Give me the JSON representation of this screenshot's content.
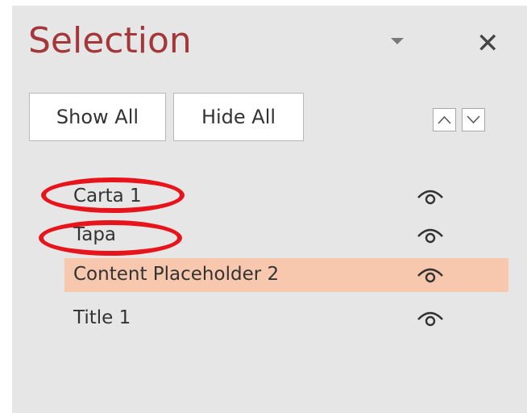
{
  "pane": {
    "title": "Selection",
    "menu_icon": "chevron-down-icon",
    "close_icon": "close-icon",
    "close_glyph": "✕"
  },
  "toolbar": {
    "show_all_label": "Show All",
    "hide_all_label": "Hide All",
    "bring_forward_icon": "chevron-up-icon",
    "send_backward_icon": "chevron-down-icon"
  },
  "layers": [
    {
      "label": "Carta 1",
      "visible": true,
      "selected": false,
      "annotated": true
    },
    {
      "label": "Tapa",
      "visible": true,
      "selected": false,
      "annotated": true
    },
    {
      "label": "Content Placeholder 2",
      "visible": true,
      "selected": true,
      "annotated": false
    },
    {
      "label": "Title 1",
      "visible": true,
      "selected": false,
      "annotated": false
    }
  ],
  "colors": {
    "title": "#a4373a",
    "selected_row": "#f8c8ae",
    "annotation": "#e8141c",
    "pane_bg": "#e6e6e6"
  }
}
